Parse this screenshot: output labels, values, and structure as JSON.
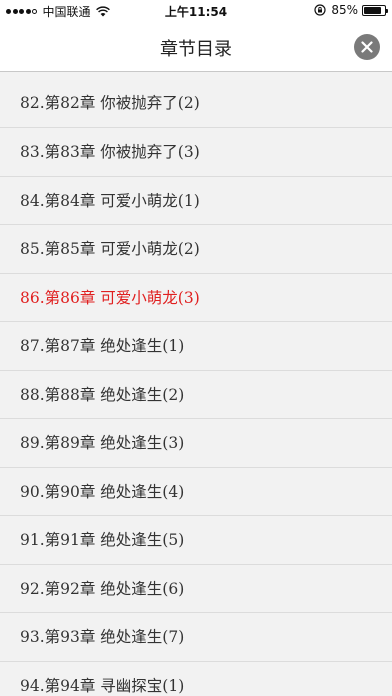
{
  "status_bar": {
    "carrier": "中国联通",
    "time": "上午11:54",
    "battery_percent": "85%",
    "battery_level": 0.85,
    "signal_bars": 4,
    "icons": [
      "signal-icon",
      "wifi-icon",
      "rotation-lock-icon",
      "battery-icon"
    ]
  },
  "header": {
    "title": "章节目录",
    "close_icon": "close-icon"
  },
  "chapters": [
    {
      "label": "82.第82章 你被抛弃了(2)",
      "current": false
    },
    {
      "label": "83.第83章 你被抛弃了(3)",
      "current": false
    },
    {
      "label": "84.第84章 可爱小萌龙(1)",
      "current": false
    },
    {
      "label": "85.第85章 可爱小萌龙(2)",
      "current": false
    },
    {
      "label": "86.第86章 可爱小萌龙(3)",
      "current": true
    },
    {
      "label": "87.第87章 绝处逢生(1)",
      "current": false
    },
    {
      "label": "88.第88章 绝处逢生(2)",
      "current": false
    },
    {
      "label": "89.第89章 绝处逢生(3)",
      "current": false
    },
    {
      "label": "90.第90章 绝处逢生(4)",
      "current": false
    },
    {
      "label": "91.第91章 绝处逢生(5)",
      "current": false
    },
    {
      "label": "92.第92章 绝处逢生(6)",
      "current": false
    },
    {
      "label": "93.第93章 绝处逢生(7)",
      "current": false
    },
    {
      "label": "94.第94章 寻幽探宝(1)",
      "current": false
    }
  ],
  "colors": {
    "current_chapter": "#e02020",
    "list_background": "#f2f2f2",
    "close_button": "#7a7a7a"
  }
}
